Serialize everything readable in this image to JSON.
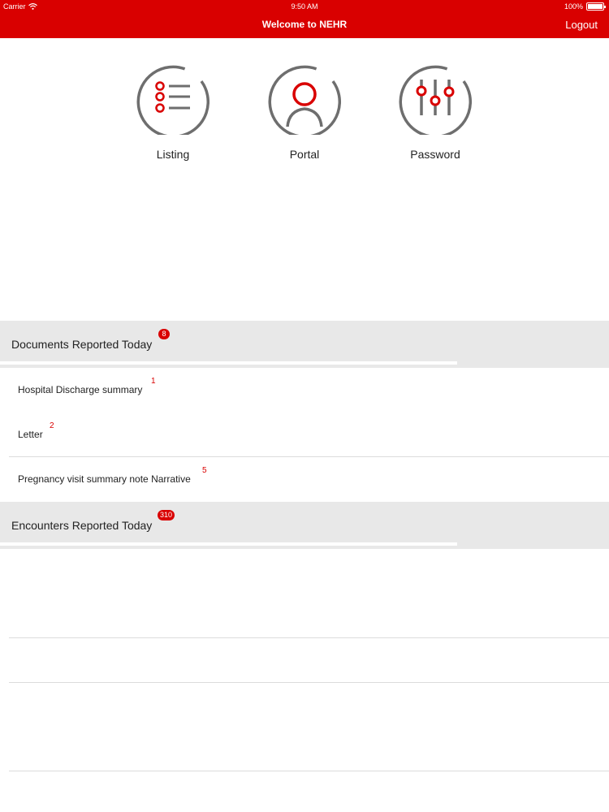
{
  "status_bar": {
    "carrier": "Carrier",
    "time": "9:50 AM",
    "battery": "100%",
    "battery_level": 1.0
  },
  "nav": {
    "title": "Welcome to NEHR",
    "logout_label": "Logout"
  },
  "menu": [
    {
      "label": "Listing",
      "icon": "list-icon"
    },
    {
      "label": "Portal",
      "icon": "user-icon"
    },
    {
      "label": "Password",
      "icon": "sliders-icon"
    }
  ],
  "documents": {
    "title": "Documents Reported Today",
    "badge": "8",
    "items": [
      {
        "label": "Hospital Discharge summary",
        "count": "1"
      },
      {
        "label": "Letter",
        "count": "2"
      },
      {
        "label": "Pregnancy visit summary note Narrative",
        "count": "5"
      }
    ]
  },
  "encounters": {
    "title": "Encounters Reported Today",
    "badge": "310"
  },
  "colors": {
    "brand": "#d90000",
    "section_bg": "#e8e8e8",
    "icon_gray": "#6e6e6e"
  }
}
